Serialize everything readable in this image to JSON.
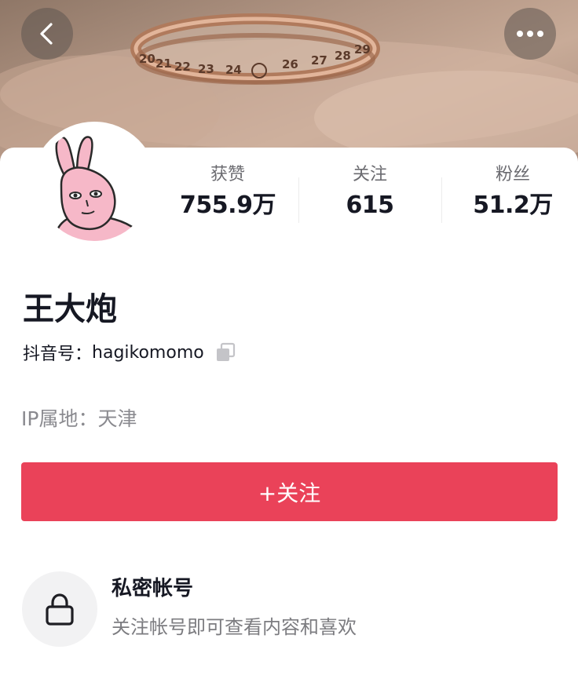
{
  "header": {
    "back_icon": "chevron-left-icon",
    "more_icon": "more-dots-icon",
    "banner_ring_numbers": [
      "20",
      "21",
      "22",
      "23",
      "24",
      "26",
      "27",
      "28",
      "29"
    ]
  },
  "profile": {
    "name": "王大炮",
    "douyin_id_label": "抖音号：",
    "douyin_id": "hagikomomo",
    "ip_location": "IP属地：天津"
  },
  "stats": [
    {
      "label": "获赞",
      "value": "755.9万"
    },
    {
      "label": "关注",
      "value": "615"
    },
    {
      "label": "粉丝",
      "value": "51.2万"
    }
  ],
  "follow_button": {
    "label": "+关注"
  },
  "private_account": {
    "title": "私密帐号",
    "description": "关注帐号即可查看内容和喜欢",
    "icon": "lock-icon"
  },
  "colors": {
    "accent": "#ea4259",
    "text_primary": "#161823",
    "text_secondary": "#8a8a8f"
  }
}
